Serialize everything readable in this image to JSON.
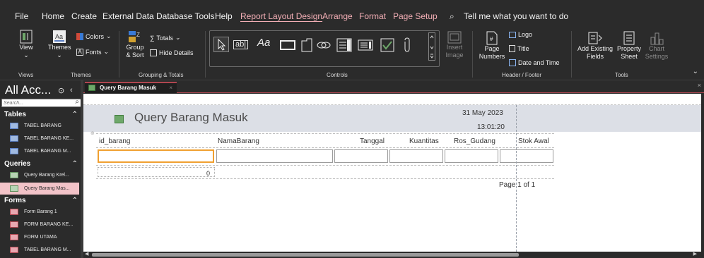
{
  "menu": {
    "file": "File",
    "home": "Home",
    "create": "Create",
    "external_data": "External Data",
    "database_tools": "Database Tools",
    "help": "Help",
    "report_layout_design": "Report Layout Design",
    "arrange": "Arrange",
    "format": "Format",
    "page_setup": "Page Setup",
    "tell_me": "Tell me what you want to do"
  },
  "ribbon": {
    "views": {
      "view": "View",
      "group": "Views"
    },
    "themes": {
      "themes": "Themes",
      "colors": "Colors",
      "fonts": "Fonts",
      "group": "Themes"
    },
    "grouping": {
      "group_sort_1": "Group",
      "group_sort_2": "& Sort",
      "totals": "Totals",
      "hide_details": "Hide Details",
      "group": "Grouping & Totals"
    },
    "controls": {
      "textbox": "ab|",
      "label": "Aa",
      "insert_image_1": "Insert",
      "insert_image_2": "Image",
      "group": "Controls"
    },
    "header_footer": {
      "page_numbers_1": "Page",
      "page_numbers_2": "Numbers",
      "logo": "Logo",
      "title": "Title",
      "date_time": "Date and Time",
      "group": "Header / Footer"
    },
    "tools": {
      "add_fields_1": "Add Existing",
      "add_fields_2": "Fields",
      "property_1": "Property",
      "property_2": "Sheet",
      "chart_1": "Chart",
      "chart_2": "Settings",
      "group": "Tools"
    }
  },
  "nav": {
    "title": "All Acc...",
    "search_placeholder": "Search...",
    "sections": [
      {
        "label": "Tables",
        "items": [
          "TABEL BARANG",
          "TABEL BARANG KE...",
          "TABEL BARANG M..."
        ]
      },
      {
        "label": "Queries",
        "items": [
          "Query Barang Krel...",
          "Query Barang Mas..."
        ]
      },
      {
        "label": "Forms",
        "items": [
          "Form Barang 1",
          "FORM BARANG KE...",
          "FORM UTAMA",
          "TABEL BARANG M..."
        ]
      }
    ]
  },
  "document": {
    "tab_label": "Query Barang Masuk",
    "report_title": "Query Barang Masuk",
    "date": "31 May 2023",
    "time": "13:01:20",
    "columns": [
      "id_barang",
      "NamaBarang",
      "Tanggal",
      "Kuantitas",
      "Ros_Gudang",
      "Stok Awal"
    ],
    "sum_value": "0",
    "page_number": "Page 1 of 1"
  },
  "colors": {
    "accent": "#b04650",
    "context_tab": "#f2aeb5",
    "selected_nav": "#f2c3c8",
    "header_band": "#dcdfe6",
    "focus_border": "#f0a030"
  }
}
